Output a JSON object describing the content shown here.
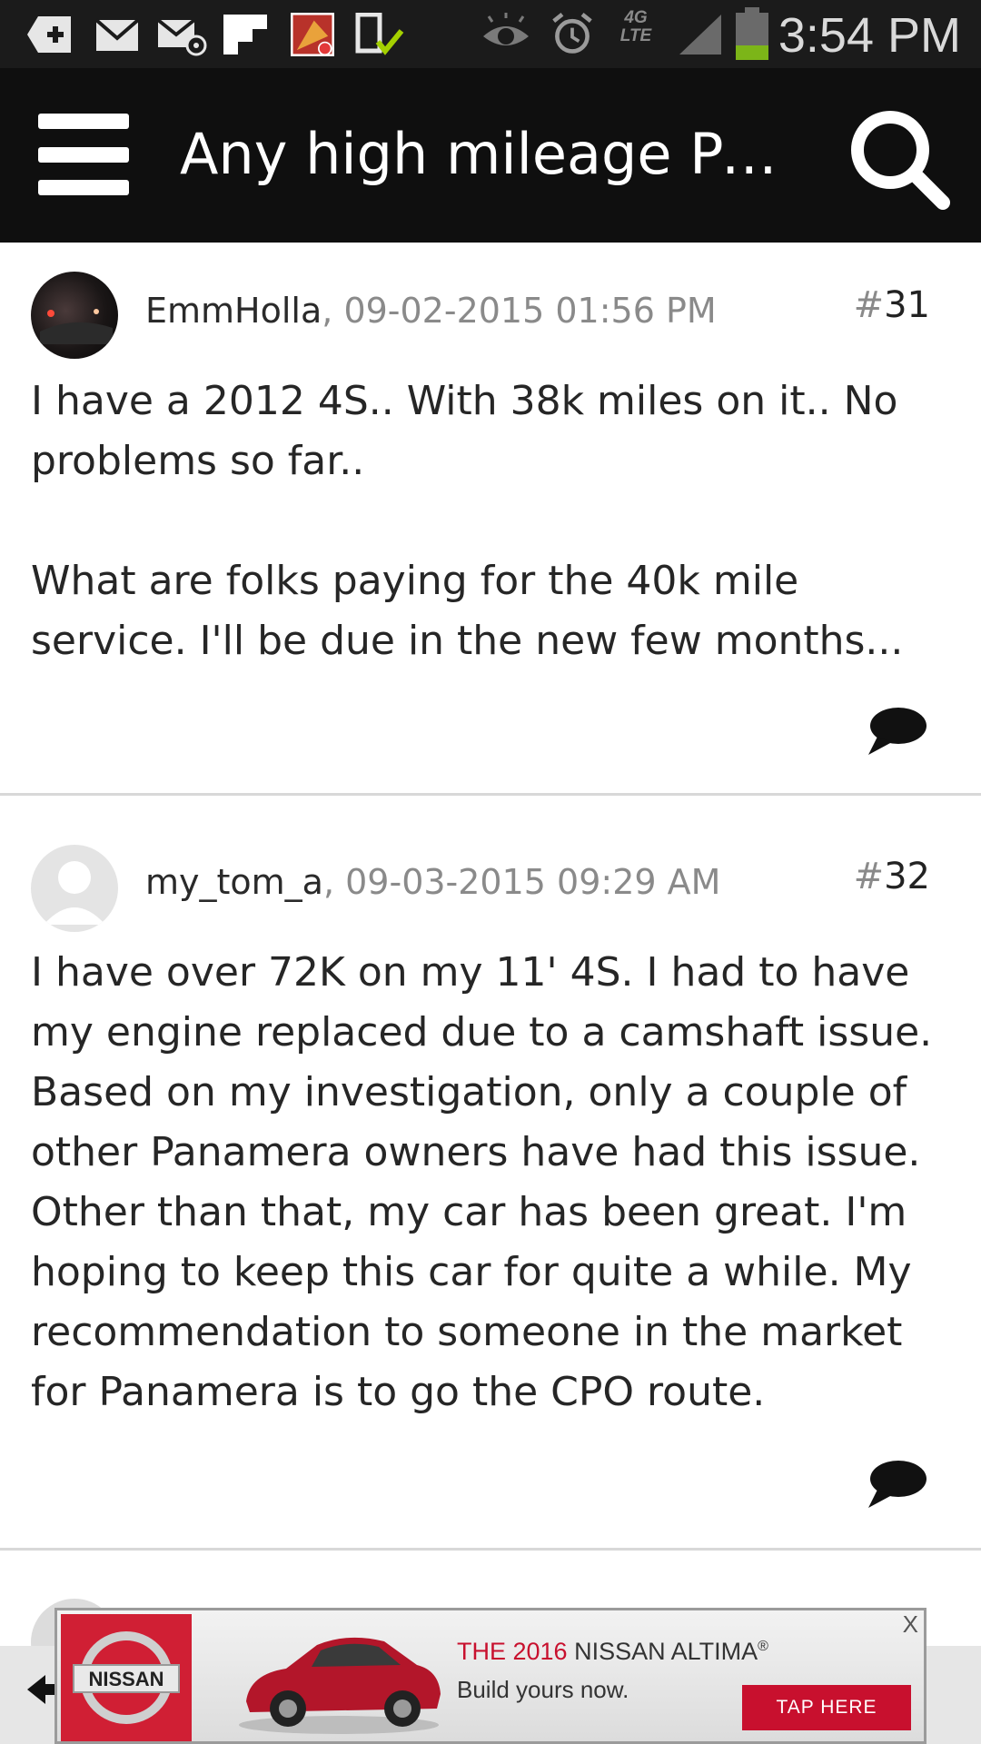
{
  "status_bar": {
    "time": "3:54 PM",
    "network_label": "4G LTE",
    "left_icons": [
      "add-box-icon",
      "mail-icon",
      "email-at-icon",
      "flipboard-icon",
      "game-notification-icon",
      "download-check-icon"
    ],
    "right_icons": [
      "eye-icon",
      "alarm-icon",
      "network-4g-icon",
      "signal-icon",
      "battery-icon"
    ],
    "battery_level": 0.3,
    "colors": {
      "background": "#1b1b1b",
      "battery_fill": "#7cb518",
      "check": "#a4d000"
    }
  },
  "app_bar": {
    "title": "Any high mileage Pan…",
    "background": "#0f0f0f"
  },
  "posts": [
    {
      "author": "EmmHolla",
      "date": ", 09-02-2015 01:56 PM",
      "number_hash": "#",
      "number": "31",
      "avatar": "car-photo-avatar",
      "paragraphs": [
        "I have a 2012 4S.. With 38k miles on it.. No problems so far..",
        "What are folks paying for the 40k mile service. I'll be due in the new few months..."
      ]
    },
    {
      "author": "my_tom_a",
      "date": ", 09-03-2015 09:29 AM",
      "number_hash": "#",
      "number": "32",
      "avatar": "default-user-avatar",
      "paragraphs": [
        "I have over 72K on my 11' 4S. I had to have my engine replaced due to a camshaft issue. Based on my investigation, only a couple of other Panamera owners have had this issue. Other than that, my car has been great. I'm hoping to keep this car for quite a while. My recommendation to someone in the market for Panamera is to go the CPO route."
      ]
    }
  ],
  "ad": {
    "brand": "NISSAN",
    "headline_accent": "THE 2016",
    "headline_rest": " NISSAN ALTIMA",
    "registered": "®",
    "subline": "Build yours now.",
    "cta": "TAP HERE",
    "close": "X",
    "accent_color": "#c8102e"
  }
}
